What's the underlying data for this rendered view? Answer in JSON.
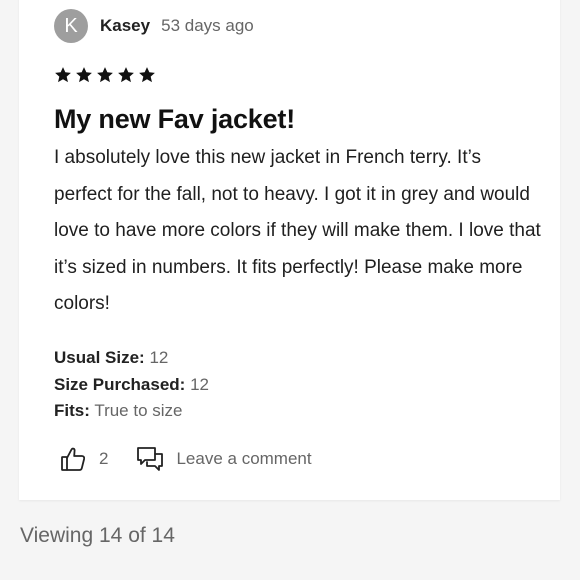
{
  "review": {
    "reviewer": {
      "initial": "K",
      "name": "Kasey",
      "posted": "53 days ago",
      "avatar_color": "#9e9e9e"
    },
    "rating": 5,
    "rating_max": 5,
    "title": "My new Fav jacket!",
    "body": "I absolutely love this new jacket in French terry. It’s perfect for the fall, not to heavy. I got it in grey and would love to have more colors if they will make them. I love that it’s sized in numbers. It fits perfectly! Please make more colors!",
    "attributes": [
      {
        "key": "Usual Size:",
        "value": "12"
      },
      {
        "key": "Size Purchased:",
        "value": "12"
      },
      {
        "key": "Fits:",
        "value": "True to size"
      }
    ],
    "actions": {
      "helpful_icon": "thumbs-up-icon",
      "helpful_count": "2",
      "comment_icon": "speech-bubble-icon",
      "comment_label": "Leave a comment"
    }
  },
  "pagination": {
    "viewing_text": "Viewing 14 of 14"
  },
  "colors": {
    "background": "#f5f5f5",
    "card": "#ffffff",
    "muted_text": "#666666",
    "star": "#111111"
  }
}
